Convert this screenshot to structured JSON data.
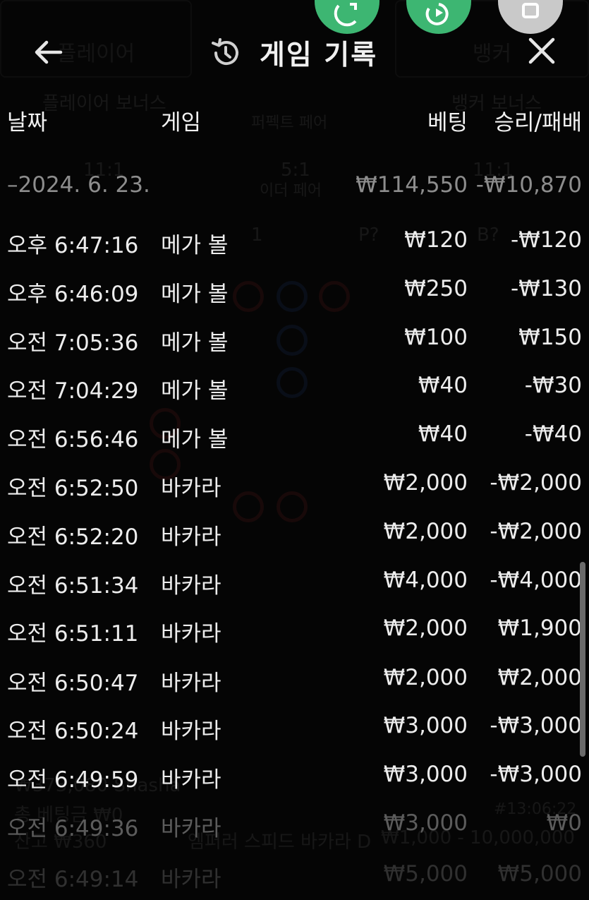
{
  "header": {
    "title": "게임 기록",
    "back_icon": "arrow-left-icon",
    "history_icon": "history-clock-icon",
    "close_icon": "close-icon"
  },
  "top_buttons": [
    {
      "icon": "refresh-icon",
      "color": "#3db672"
    },
    {
      "icon": "replay-icon",
      "color": "#3db672"
    },
    {
      "icon": "stop-icon",
      "color": "#c9c9c9"
    }
  ],
  "background": {
    "labels": [
      "플레이어",
      "뱅커",
      "플레이어 보너스",
      "퍼펙트 페어",
      "뱅커 보너스",
      "11:1",
      "5:1",
      "11:1",
      "이더 페어",
      "1",
      "P?",
      "B?",
      "₩373,080 Shasha",
      "총 베팅금 ₩0",
      "잔고 ₩360",
      "#13:06:22",
      "엠퍼러 스피드 바카라 D",
      "₩1,000 - 10,000,000"
    ]
  },
  "table": {
    "columns": {
      "date": "날짜",
      "game": "게임",
      "bet": "베팅",
      "winloss": "승리/패배"
    },
    "group": {
      "date": "–2024. 6. 23.",
      "bet": "₩114,550",
      "winloss": "-₩10,870"
    },
    "rows": [
      {
        "time": "오후 6:47:16",
        "game": "메가 볼",
        "bet": "₩120",
        "winloss": "-₩120"
      },
      {
        "time": "오후 6:46:09",
        "game": "메가 볼",
        "bet": "₩250",
        "winloss": "-₩130"
      },
      {
        "time": "오전 7:05:36",
        "game": "메가 볼",
        "bet": "₩100",
        "winloss": "₩150"
      },
      {
        "time": "오전 7:04:29",
        "game": "메가 볼",
        "bet": "₩40",
        "winloss": "-₩30"
      },
      {
        "time": "오전 6:56:46",
        "game": "메가 볼",
        "bet": "₩40",
        "winloss": "-₩40"
      },
      {
        "time": "오전 6:52:50",
        "game": "바카라",
        "bet": "₩2,000",
        "winloss": "-₩2,000"
      },
      {
        "time": "오전 6:52:20",
        "game": "바카라",
        "bet": "₩2,000",
        "winloss": "-₩2,000"
      },
      {
        "time": "오전 6:51:34",
        "game": "바카라",
        "bet": "₩4,000",
        "winloss": "-₩4,000"
      },
      {
        "time": "오전 6:51:11",
        "game": "바카라",
        "bet": "₩2,000",
        "winloss": "₩1,900"
      },
      {
        "time": "오전 6:50:47",
        "game": "바카라",
        "bet": "₩2,000",
        "winloss": "₩2,000"
      },
      {
        "time": "오전 6:50:24",
        "game": "바카라",
        "bet": "₩3,000",
        "winloss": "-₩3,000"
      },
      {
        "time": "오전 6:49:59",
        "game": "바카라",
        "bet": "₩3,000",
        "winloss": "-₩3,000"
      },
      {
        "time": "오전 6:49:36",
        "game": "바카라",
        "bet": "₩3,000",
        "winloss": "₩0"
      },
      {
        "time": "오전 6:49:14",
        "game": "바카라",
        "bet": "₩5,000",
        "winloss": "₩5,000"
      }
    ]
  }
}
